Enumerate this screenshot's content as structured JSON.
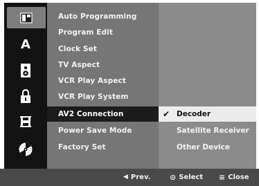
{
  "rail": {
    "items": [
      {
        "icon": "disc-setup-icon",
        "active": true
      },
      {
        "icon": "language-icon",
        "label": "A",
        "active": false
      },
      {
        "icon": "audio-icon",
        "active": false
      },
      {
        "icon": "lock-icon",
        "active": false
      },
      {
        "icon": "recording-icon",
        "active": false
      },
      {
        "icon": "disc-icon",
        "active": false
      }
    ]
  },
  "menu": {
    "items": [
      {
        "label": "Auto Programming"
      },
      {
        "label": "Program Edit"
      },
      {
        "label": "Clock Set"
      },
      {
        "label": "TV Aspect"
      },
      {
        "label": "VCR Play Aspect"
      },
      {
        "label": "VCR Play System"
      },
      {
        "label": "AV2 Connection",
        "selected": true
      },
      {
        "label": "Power Save Mode"
      },
      {
        "label": "Factory Set"
      }
    ]
  },
  "submenu": {
    "items": [
      {
        "label": "Decoder",
        "checked": true,
        "selected": true
      },
      {
        "label": "Satellite Receiver"
      },
      {
        "label": "Other Device"
      }
    ],
    "check_glyph": "✔"
  },
  "footer": {
    "prev_icon": "◀",
    "prev_label": "Prev.",
    "select_icon": "⊙",
    "select_label": "Select",
    "close_icon": "≡",
    "close_label": "Close"
  }
}
